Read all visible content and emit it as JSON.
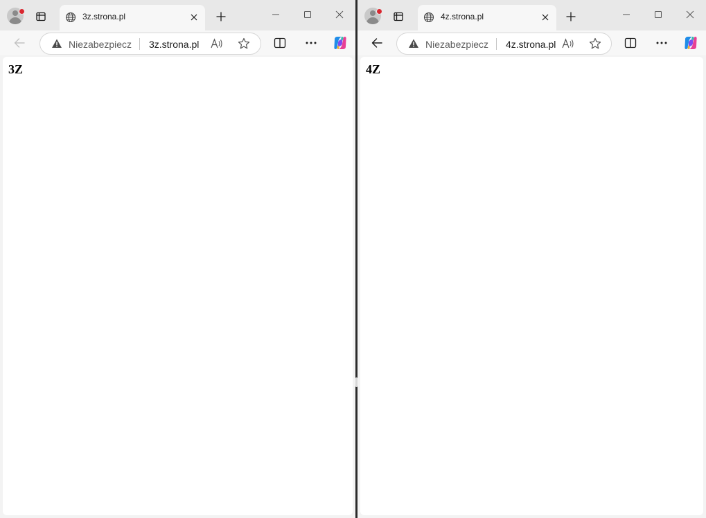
{
  "left_window": {
    "tab": {
      "title": "3z.strona.pl",
      "icon": "globe-icon"
    },
    "address_bar": {
      "security_label": "Niezabezpieczona",
      "url": "3z.strona.pl"
    },
    "back_enabled": false,
    "page": {
      "heading": "3Z"
    }
  },
  "right_window": {
    "tab": {
      "title": "4z.strona.pl",
      "icon": "globe-icon"
    },
    "address_bar": {
      "security_label": "Niezabezpieczona",
      "url": "4z.strona.pl"
    },
    "back_enabled": true,
    "page": {
      "heading": "4Z"
    }
  },
  "colors": {
    "titlebar": "#e8e8e8",
    "toolbar": "#f7f7f7",
    "notification_dot": "#d9262f",
    "divider": "#2b2b2b"
  }
}
